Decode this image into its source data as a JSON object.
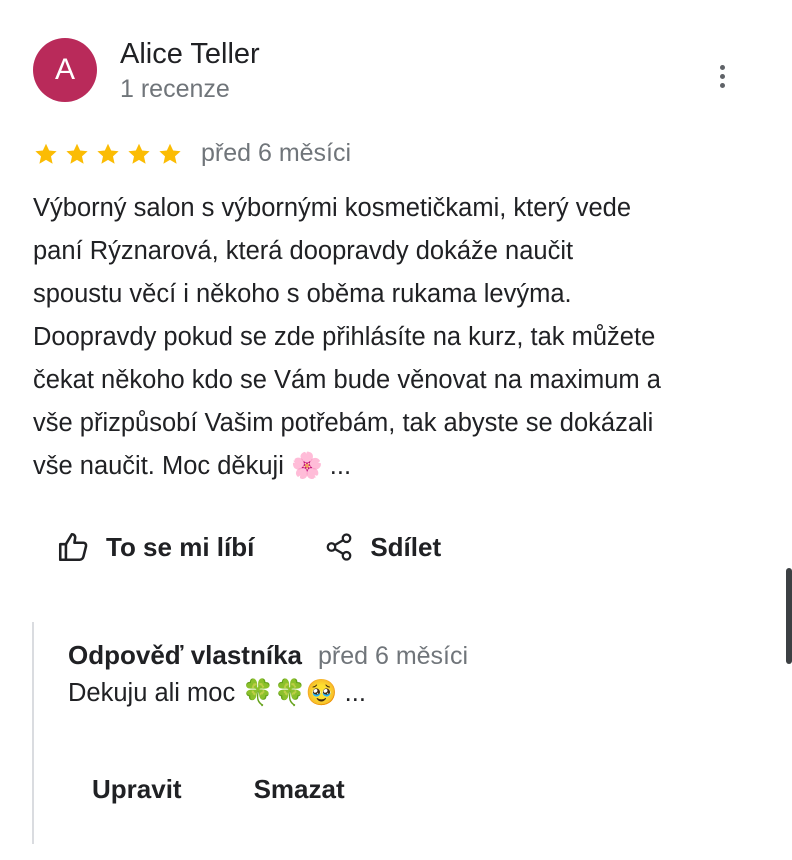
{
  "review": {
    "avatar_initial": "A",
    "avatar_color": "#b92a5a",
    "author": "Alice Teller",
    "review_count": "1 recenze",
    "more_icon": "more-vert-icon",
    "rating": 5,
    "star_color": "#fbbc04",
    "relative_date": "před 6 měsíci",
    "text_lines": [
      "Výborný salon s výbornými kosmetičkami, který vede",
      "paní Rýznarová, která doopravdy dokáže naučit",
      "spoustu věcí i někoho s oběma rukama levýma.",
      "Doopravdy pokud se zde přihlásíte na kurz, tak můžete",
      "čekat někoho kdo se Vám bude věnovat na maximum a",
      "vše přizpůsobí Vašim potřebám, tak abyste se dokázali",
      "vše naučit. Moc děkuji 🌸 ..."
    ]
  },
  "actions": {
    "like_label": "To se mi líbí",
    "like_icon": "thumbs-up-icon",
    "share_label": "Sdílet",
    "share_icon": "share-icon"
  },
  "owner_reply": {
    "title": "Odpověď vlastníka",
    "relative_date": "před 6 měsíci",
    "text": "Dekuju ali moc 🍀🍀🥹 ...",
    "edit_label": "Upravit",
    "delete_label": "Smazat"
  }
}
